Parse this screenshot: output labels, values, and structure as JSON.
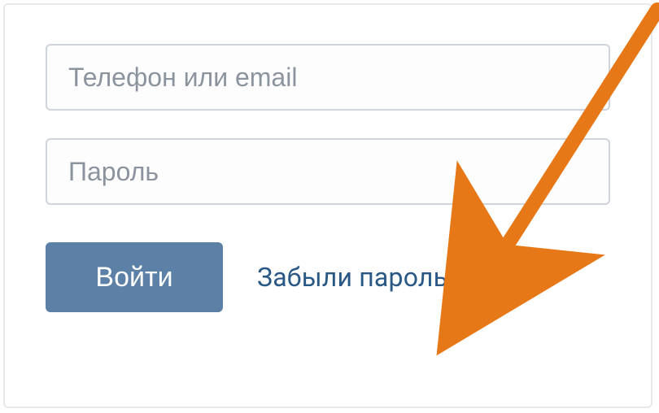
{
  "login": {
    "phone_or_email_placeholder": "Телефон или email",
    "password_placeholder": "Пароль",
    "submit_label": "Войти",
    "forgot_label": "Забыли пароль?"
  },
  "annotation": {
    "arrow_color": "#e77817"
  }
}
